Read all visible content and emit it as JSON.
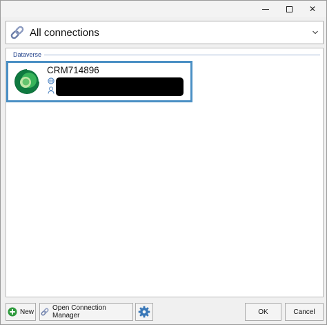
{
  "window": {
    "controls": {
      "minimize": "minimize-icon",
      "maximize": "maximize-icon",
      "close": "✕"
    }
  },
  "selector": {
    "value": "All connections",
    "icon": "link-icon"
  },
  "list": {
    "group_label": "Dataverse",
    "items": [
      {
        "name": "CRM714896",
        "icon": "dataverse-logo",
        "url_icon": "globe-icon",
        "user_icon": "user-icon",
        "details_redacted": true
      }
    ]
  },
  "footer": {
    "new_label": "New",
    "open_manager_label": "Open Connection Manager",
    "ok_label": "OK",
    "cancel_label": "Cancel"
  },
  "colors": {
    "selection_border": "#4a8fc4",
    "group_label": "#1e3f8a",
    "add_icon": "#2e9a3c",
    "gear_icon": "#3a78b8"
  }
}
